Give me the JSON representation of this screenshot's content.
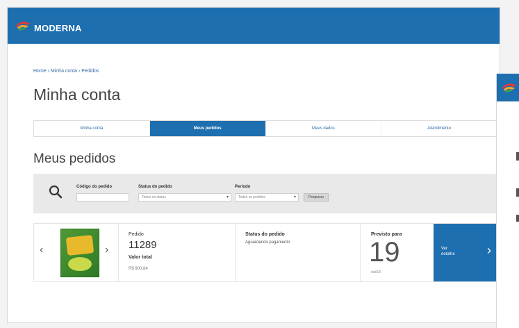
{
  "brand": {
    "name": "MODERNA",
    "color": "#1e6fb0"
  },
  "breadcrumb": "Home › Minha conta › Pedidos",
  "page_title": "Minha conta",
  "tabs": [
    {
      "label": "Minha conta",
      "active": false
    },
    {
      "label": "Meus pedidos",
      "active": true
    },
    {
      "label": "Meus dados",
      "active": false
    },
    {
      "label": "Atendimento",
      "active": false
    }
  ],
  "section_title": "Meus pedidos",
  "filters": {
    "search_icon": "search-icon",
    "order_code_label": "Código do pedido",
    "order_code_value": "",
    "status_label": "Status do pedido",
    "status_value": "Todos os status",
    "period_label": "Período",
    "period_value": "Todos os pedidos",
    "search_button": "Pesquisar"
  },
  "order": {
    "prev_icon": "chevron-left-icon",
    "next_icon": "chevron-right-icon",
    "order_label": "Pedido",
    "order_number": "11289",
    "total_label": "Valor total",
    "total_value": "R$ 900,84",
    "status_label": "Status do pedido",
    "status_value": "Aguardando pagamento",
    "forecast_label": "Previsto para",
    "forecast_day": "19",
    "forecast_month": "out/18",
    "details_button": "Ver detalhe",
    "details_icon": "chevron-right-icon"
  }
}
